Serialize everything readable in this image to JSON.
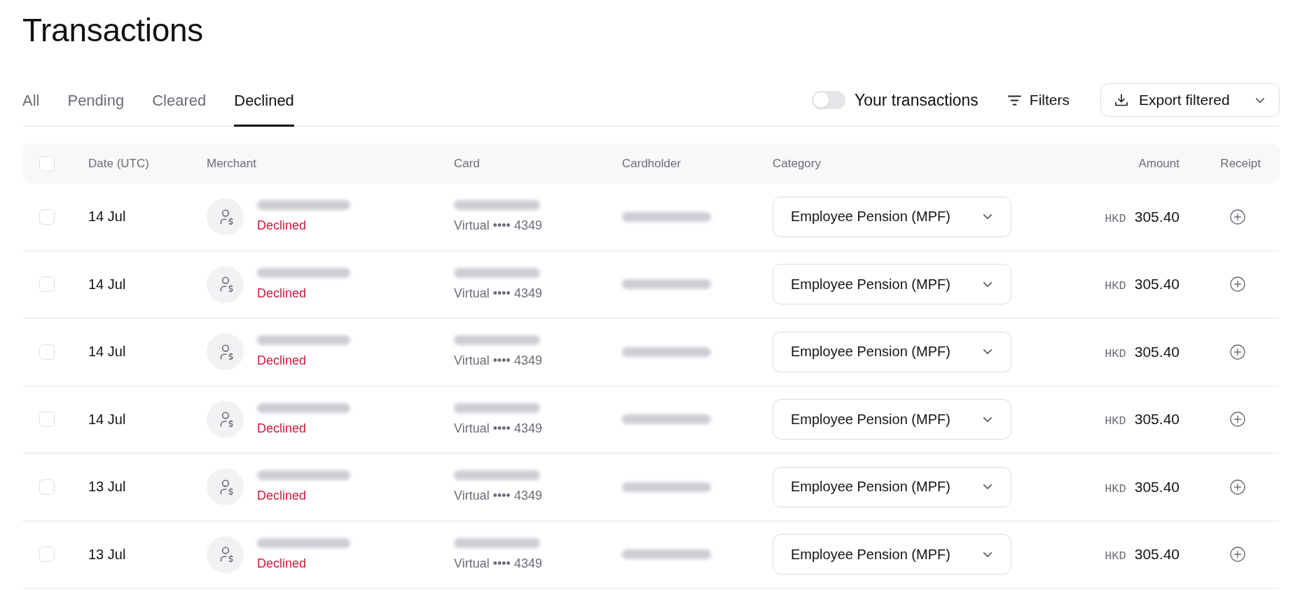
{
  "title": "Transactions",
  "tabs": [
    {
      "label": "All",
      "selected": false
    },
    {
      "label": "Pending",
      "selected": false
    },
    {
      "label": "Cleared",
      "selected": false
    },
    {
      "label": "Declined",
      "selected": true
    }
  ],
  "toolbar": {
    "your_transactions": {
      "label": "Your transactions",
      "on": false
    },
    "filters": {
      "label": "Filters"
    },
    "export": {
      "label": "Export filtered"
    }
  },
  "table": {
    "select_all": {
      "checked": false
    },
    "columns": [
      "Date (UTC)",
      "Merchant",
      "Card",
      "Cardholder",
      "Category",
      "Amount",
      "Receipt"
    ],
    "rows": [
      {
        "checked": false,
        "date": "14 Jul",
        "status": "Declined",
        "card": "Virtual •••• 4349",
        "category": "Employee Pension (MPF)",
        "currency": "HKD",
        "amount": "305.40"
      },
      {
        "checked": false,
        "date": "14 Jul",
        "status": "Declined",
        "card": "Virtual •••• 4349",
        "category": "Employee Pension (MPF)",
        "currency": "HKD",
        "amount": "305.40"
      },
      {
        "checked": false,
        "date": "14 Jul",
        "status": "Declined",
        "card": "Virtual •••• 4349",
        "category": "Employee Pension (MPF)",
        "currency": "HKD",
        "amount": "305.40"
      },
      {
        "checked": false,
        "date": "14 Jul",
        "status": "Declined",
        "card": "Virtual •••• 4349",
        "category": "Employee Pension (MPF)",
        "currency": "HKD",
        "amount": "305.40"
      },
      {
        "checked": false,
        "date": "13 Jul",
        "status": "Declined",
        "card": "Virtual •••• 4349",
        "category": "Employee Pension (MPF)",
        "currency": "HKD",
        "amount": "305.40"
      },
      {
        "checked": false,
        "date": "13 Jul",
        "status": "Declined",
        "card": "Virtual •••• 4349",
        "category": "Employee Pension (MPF)",
        "currency": "HKD",
        "amount": "305.40"
      }
    ]
  }
}
